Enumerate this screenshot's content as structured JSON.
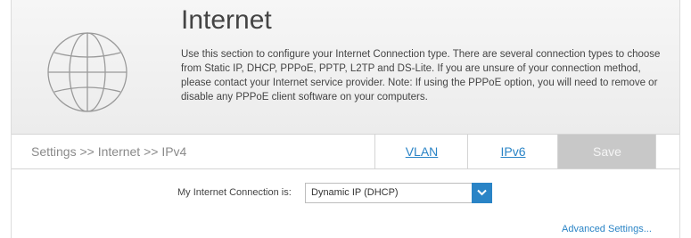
{
  "header": {
    "title": "Internet",
    "description": "Use this section to configure your Internet Connection type. There are several connection types to choose from Static IP, DHCP, PPPoE, PPTP, L2TP and DS-Lite. If you are unsure of your connection method, please contact your Internet service provider. Note: If using the PPPoE option, you will need to remove or disable any PPPoE client software on your computers."
  },
  "nav": {
    "breadcrumb": "Settings >> Internet >> IPv4",
    "tabs": [
      {
        "label": "VLAN"
      },
      {
        "label": "IPv6"
      }
    ],
    "save_label": "Save"
  },
  "form": {
    "connection_label": "My Internet Connection is:",
    "connection_value": "Dynamic IP (DHCP)",
    "advanced_link": "Advanced Settings..."
  },
  "icons": {
    "globe": "globe-icon",
    "dropdown": "chevron-down-icon"
  },
  "colors": {
    "accent": "#2a84c6",
    "save_disabled": "#c8c8c8"
  }
}
